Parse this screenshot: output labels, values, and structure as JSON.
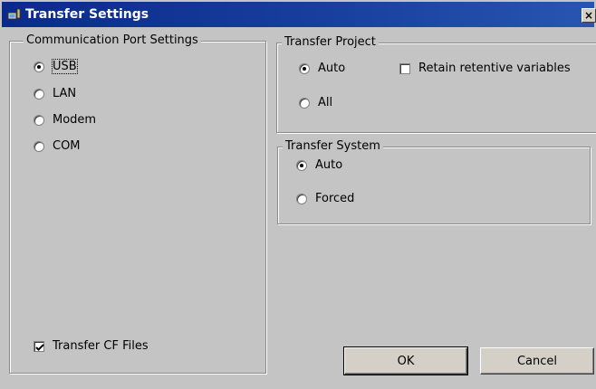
{
  "window": {
    "title": "Transfer Settings",
    "close_label": "×"
  },
  "comm_port": {
    "legend": "Communication Port Settings",
    "options": [
      {
        "label": "USB",
        "selected": true
      },
      {
        "label": "LAN",
        "selected": false
      },
      {
        "label": "Modem",
        "selected": false
      },
      {
        "label": "COM",
        "selected": false
      }
    ],
    "transfer_cf": {
      "label": "Transfer CF Files",
      "checked": true
    }
  },
  "transfer_project": {
    "legend": "Transfer Project",
    "options": [
      {
        "label": "Auto",
        "selected": true
      },
      {
        "label": "All",
        "selected": false
      }
    ],
    "retain": {
      "label": "Retain retentive variables",
      "checked": false
    }
  },
  "transfer_system": {
    "legend": "Transfer System",
    "options": [
      {
        "label": "Auto",
        "selected": true
      },
      {
        "label": "Forced",
        "selected": false
      }
    ]
  },
  "buttons": {
    "ok": "OK",
    "cancel": "Cancel"
  }
}
